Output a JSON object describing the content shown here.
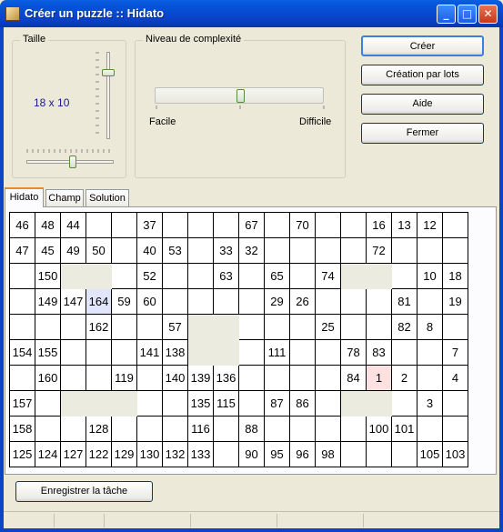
{
  "window": {
    "title": "Créer un puzzle :: Hidato"
  },
  "size_group": {
    "label": "Taille",
    "value": "18 x 10"
  },
  "complexity_group": {
    "label": "Niveau de complexité",
    "easy": "Facile",
    "hard": "Difficile",
    "level_fraction": 0.5
  },
  "buttons": {
    "create": "Créer",
    "batch": "Création par lots",
    "help": "Aide",
    "close": "Fermer",
    "save_task": "Enregistrer la tâche"
  },
  "tabs": [
    "Hidato",
    "Champ",
    "Solution"
  ],
  "grid": [
    [
      "46",
      "48",
      "44",
      "",
      "",
      "37",
      "",
      "",
      "",
      "67",
      "",
      "70",
      "",
      "",
      "16",
      "13",
      "12",
      ""
    ],
    [
      "47",
      "45",
      "49",
      "50",
      "",
      "40",
      "53",
      "",
      "33",
      "32",
      "",
      "",
      "",
      "",
      "72",
      "",
      "",
      ""
    ],
    [
      "",
      "150",
      "#",
      "#",
      "",
      "52",
      "",
      "",
      "63",
      "",
      "65",
      "",
      "74",
      "#",
      "#",
      "",
      "10",
      "18"
    ],
    [
      "",
      "149",
      "147",
      "164",
      "59",
      "60",
      "",
      "",
      "",
      "",
      "29",
      "26",
      "",
      "",
      "",
      "81",
      "",
      "19"
    ],
    [
      "",
      "",
      "",
      "162",
      "",
      "",
      "57",
      "#",
      "#",
      "",
      "",
      "",
      "25",
      "",
      "",
      "82",
      "8",
      ""
    ],
    [
      "154",
      "155",
      "",
      "",
      "",
      "141",
      "138",
      "#",
      "#",
      "",
      "111",
      "",
      "",
      "78",
      "83",
      "",
      "",
      "7"
    ],
    [
      "",
      "160",
      "",
      "",
      "119",
      "",
      "140",
      "139",
      "136",
      "",
      "",
      "",
      "",
      "84",
      "1",
      "2",
      "",
      "4"
    ],
    [
      "157",
      "",
      "#",
      "#",
      "#",
      "",
      "",
      "135",
      "115",
      "",
      "87",
      "86",
      "",
      "#",
      "#",
      "",
      "3",
      ""
    ],
    [
      "158",
      "",
      "",
      "128",
      "",
      "",
      "",
      "116",
      "",
      "88",
      "",
      "",
      "",
      "",
      "100",
      "101",
      "",
      ""
    ],
    [
      "125",
      "124",
      "127",
      "122",
      "129",
      "130",
      "132",
      "133",
      "",
      "90",
      "95",
      "96",
      "98",
      "",
      "",
      "",
      "105",
      "103"
    ]
  ],
  "grid_highlights": {
    "blue": [
      3,
      3
    ],
    "red": [
      6,
      14
    ]
  }
}
